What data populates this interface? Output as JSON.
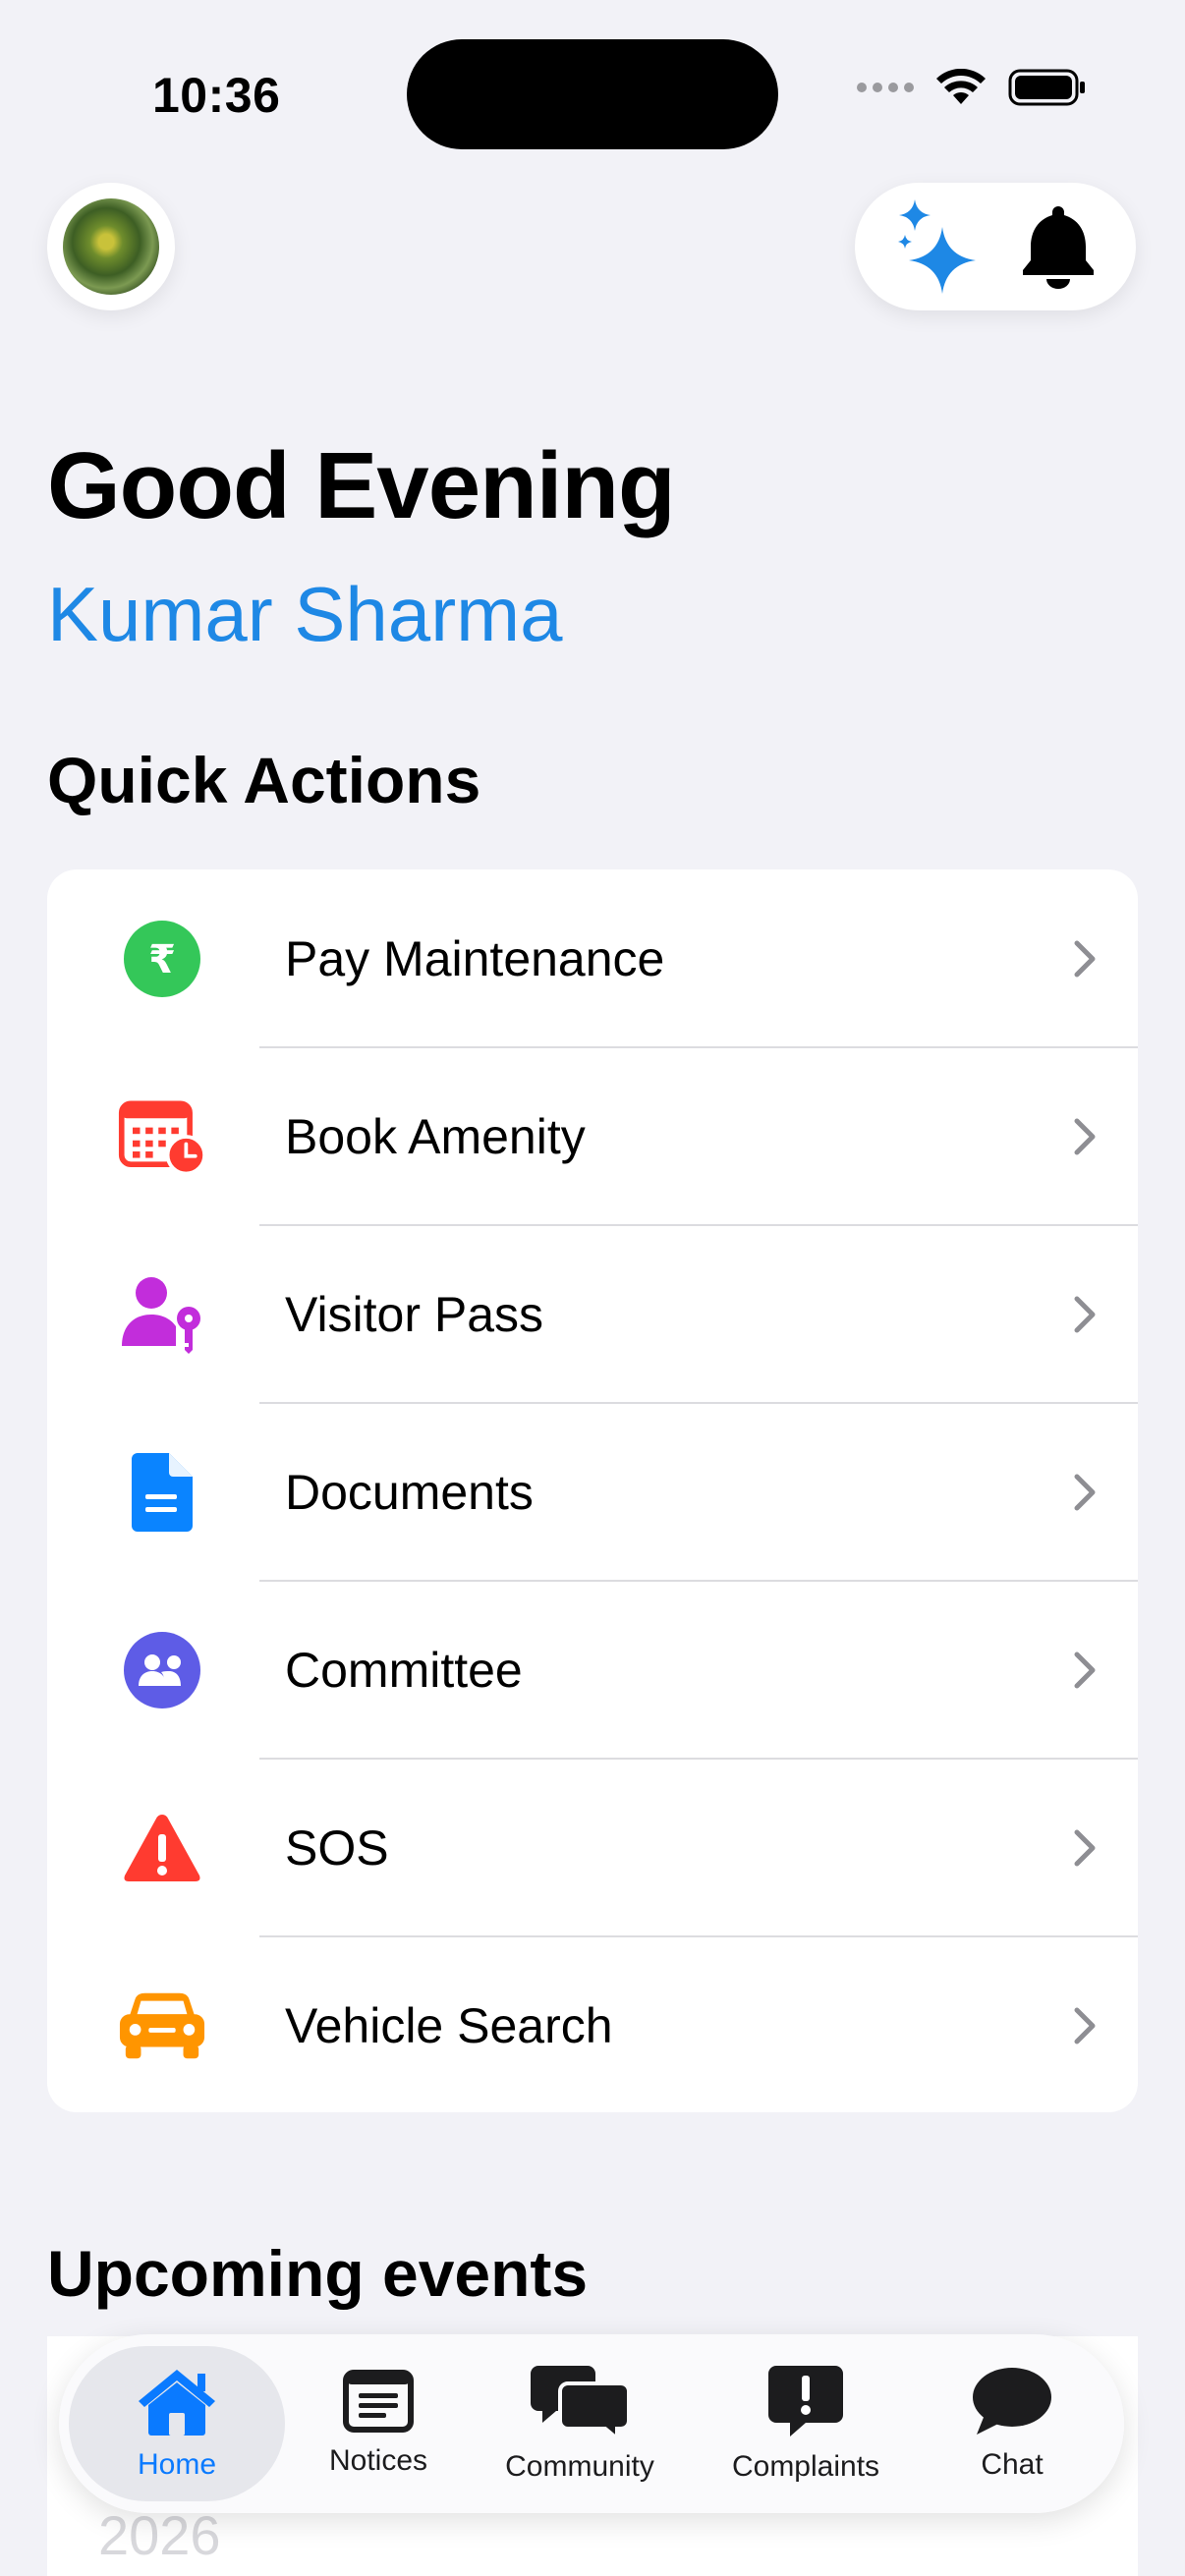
{
  "status_bar": {
    "time": "10:36"
  },
  "header": {
    "greeting": "Good Evening",
    "user_name": "Kumar Sharma",
    "colors": {
      "accent": "#1e88e5"
    }
  },
  "quick_actions": {
    "title": "Quick Actions",
    "items": [
      {
        "label": "Pay Maintenance",
        "icon": "rupee-circle-icon",
        "color": "#34c759"
      },
      {
        "label": "Book Amenity",
        "icon": "calendar-clock-icon",
        "color": "#ff3b30"
      },
      {
        "label": "Visitor Pass",
        "icon": "person-key-icon",
        "color": "#c22ddb"
      },
      {
        "label": "Documents",
        "icon": "document-icon",
        "color": "#0a84ff"
      },
      {
        "label": "Committee",
        "icon": "people-circle-icon",
        "color": "#5e5ce6"
      },
      {
        "label": "SOS",
        "icon": "warning-triangle-icon",
        "color": "#ff3b30"
      },
      {
        "label": "Vehicle Search",
        "icon": "car-icon",
        "color": "#ff9500"
      }
    ]
  },
  "upcoming_events": {
    "title": "Upcoming events",
    "year": "2026"
  },
  "tab_bar": {
    "tabs": [
      {
        "label": "Home",
        "icon": "house-icon",
        "active": true
      },
      {
        "label": "Notices",
        "icon": "newspaper-icon",
        "active": false
      },
      {
        "label": "Community",
        "icon": "chat-bubbles-icon",
        "active": false
      },
      {
        "label": "Complaints",
        "icon": "exclamation-bubble-icon",
        "active": false
      },
      {
        "label": "Chat",
        "icon": "chat-bubble-icon",
        "active": false
      }
    ],
    "active_color": "#0a7aff"
  }
}
